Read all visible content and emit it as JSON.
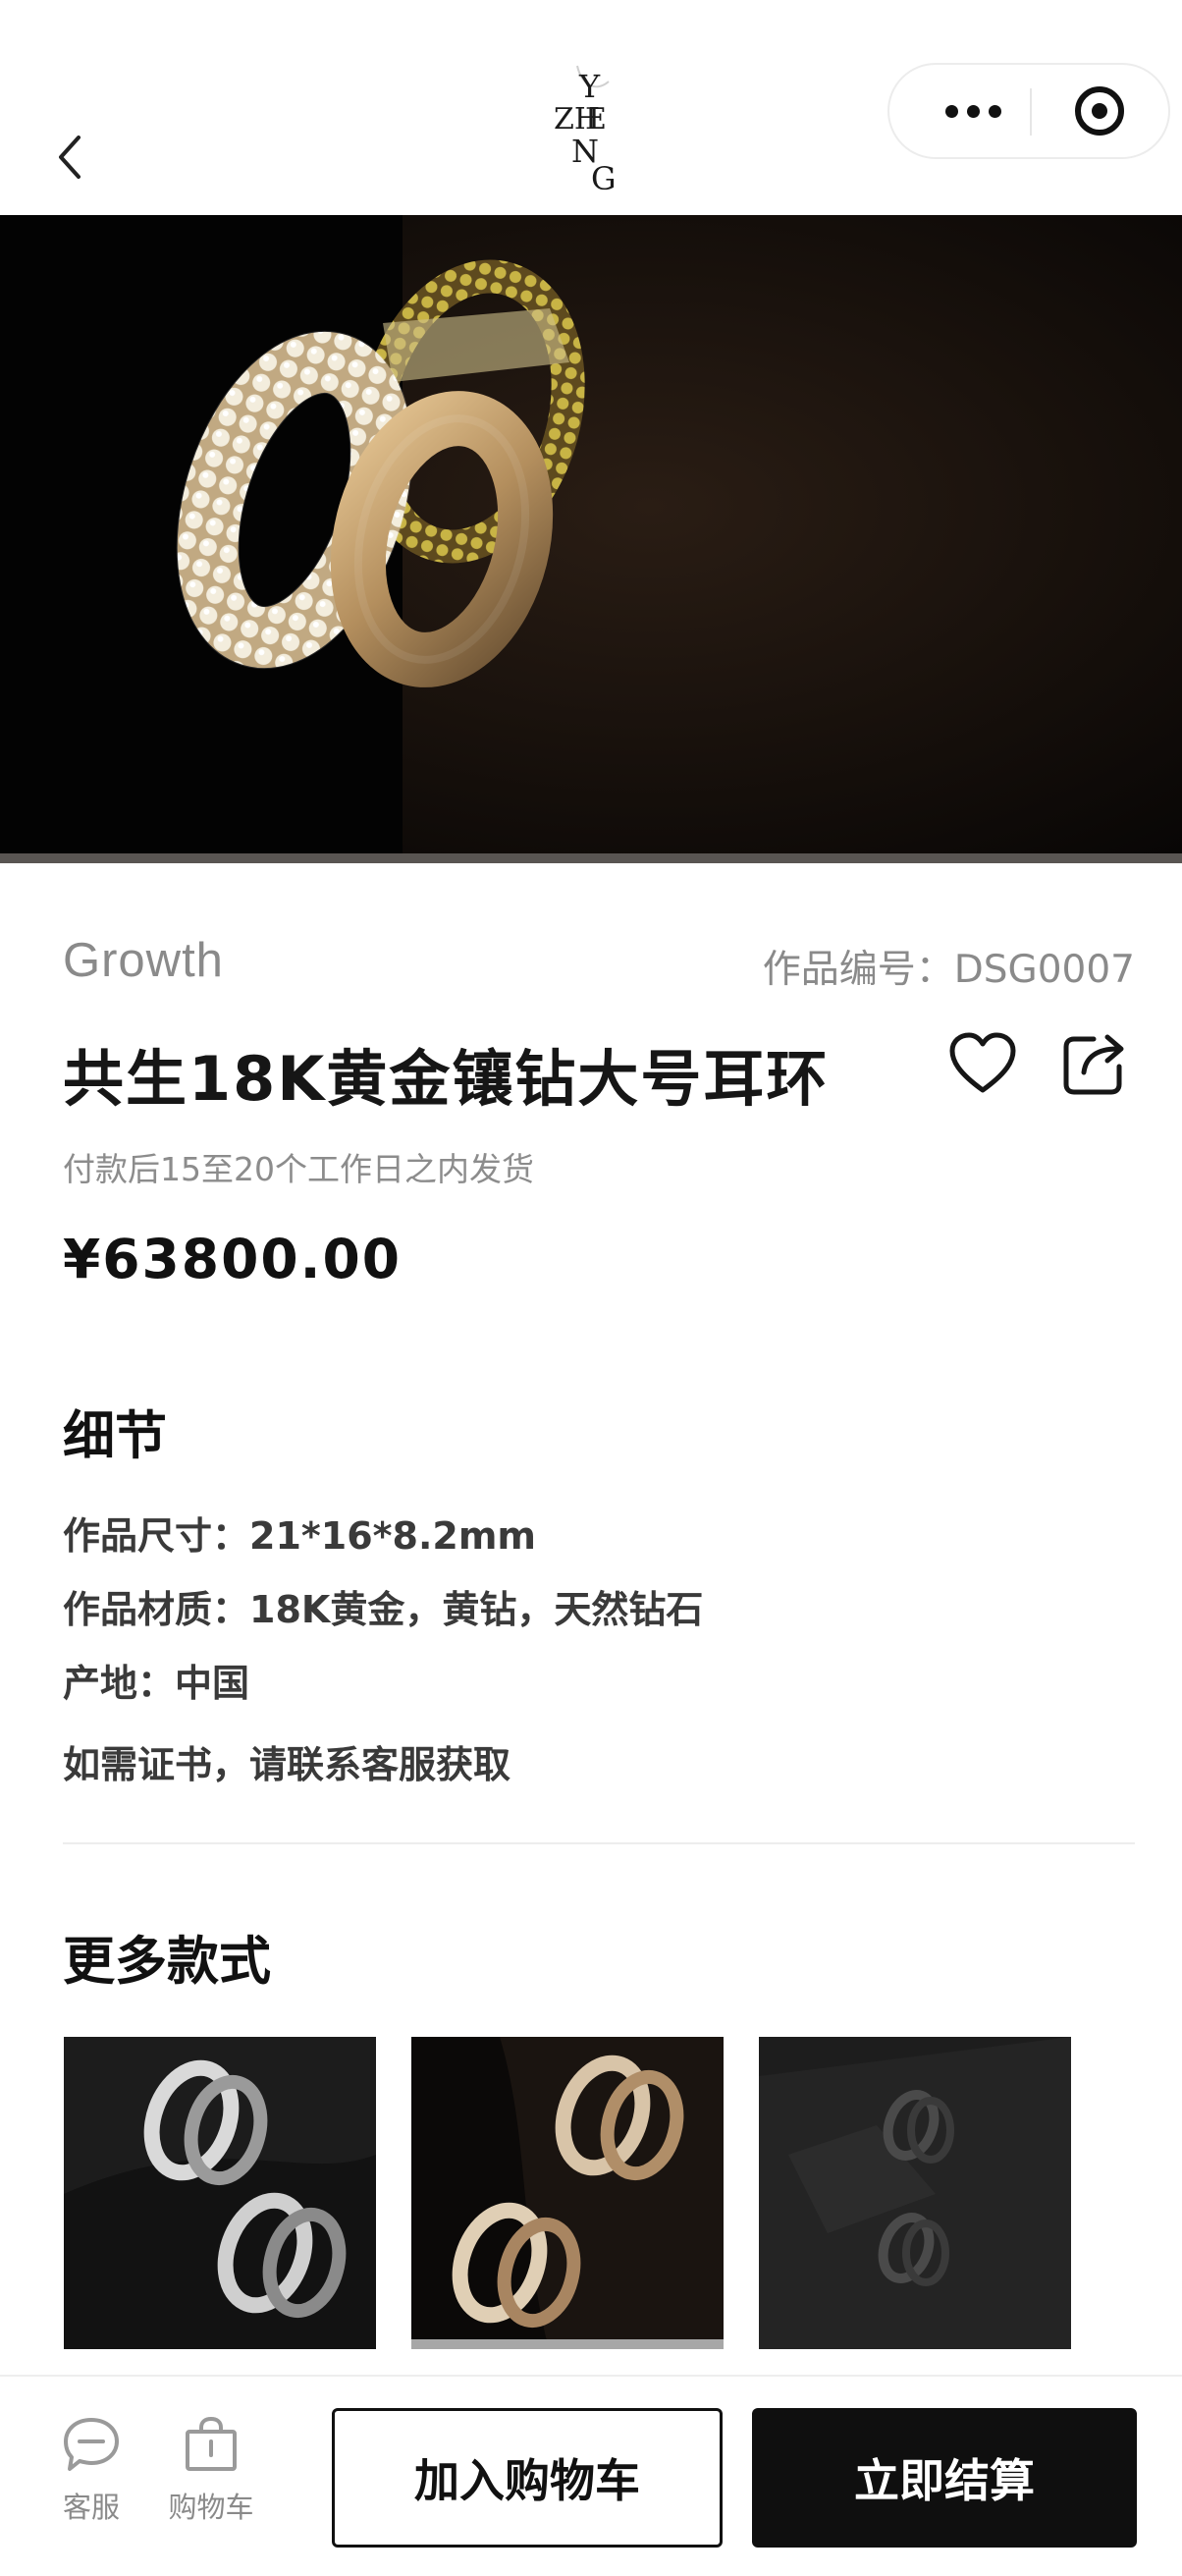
{
  "header": {
    "logo_letters": [
      "Y",
      "ZH",
      "E",
      "N",
      "G"
    ],
    "back_icon": "chevron-left-icon",
    "more_icon": "more-dots-icon",
    "close_icon": "target-circle-icon"
  },
  "product": {
    "collection": "Growth",
    "code_label": "作品编号：DSG0007",
    "title": "共生18K黄金镶钻大号耳环",
    "shipping": "付款后15至20个工作日之内发货",
    "price": "¥63800.00",
    "favorite_icon": "heart-icon",
    "share_icon": "share-icon"
  },
  "details": {
    "heading": "细节",
    "items": [
      "作品尺寸：21*16*8.2mm",
      "作品材质：18K黄金，黄钻，天然钻石",
      "产地：中国",
      "如需证书，请联系客服获取"
    ]
  },
  "more_styles": {
    "heading": "更多款式",
    "thumbnails": [
      {
        "name": "white-gold-variant",
        "active": false
      },
      {
        "name": "rose-gold-variant",
        "active": true
      },
      {
        "name": "black-variant",
        "active": false
      }
    ]
  },
  "bottom_bar": {
    "service_label": "客服",
    "service_icon": "chat-bubble-icon",
    "cart_label": "购物车",
    "cart_icon": "shopping-bag-icon",
    "add_to_cart": "加入购物车",
    "checkout": "立即结算"
  },
  "colors": {
    "primary": "#0f0f0f",
    "muted_text": "#8a8a8a",
    "gold": "#c9a46a"
  }
}
